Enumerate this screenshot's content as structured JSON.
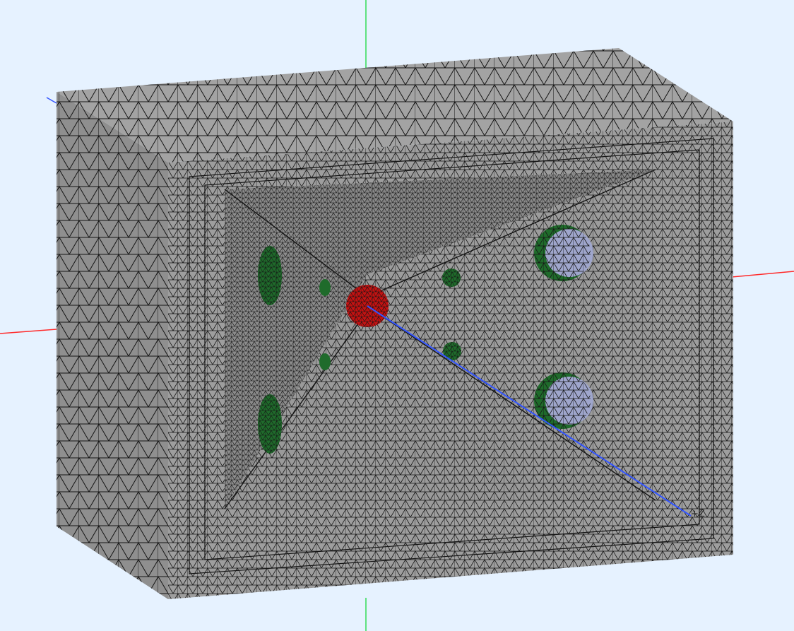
{
  "viewport": {
    "background": "#e6f2ff",
    "render_style": "surface with mesh edges"
  },
  "axes": {
    "x": {
      "color": "#ff2a2a"
    },
    "y": {
      "color": "#33dd55"
    },
    "z": {
      "color": "#3355ff",
      "label": "+Z"
    }
  },
  "model": {
    "body_color": "#9a9a9a",
    "face_shades": {
      "top": "#a3a3a3",
      "left": "#8f8f8f",
      "front": "#9e9e9e",
      "cavity": "#969696"
    },
    "edge_color": "#151515"
  },
  "regions": {
    "central_port": {
      "color": "#c41212"
    },
    "small_ports": {
      "color": "#1f6b2b"
    },
    "side_ports": {
      "color": "#1f6b2b"
    },
    "large_ports": {
      "fill_color": "#9fa6cc",
      "rim_color": "#1f6b2b"
    }
  }
}
